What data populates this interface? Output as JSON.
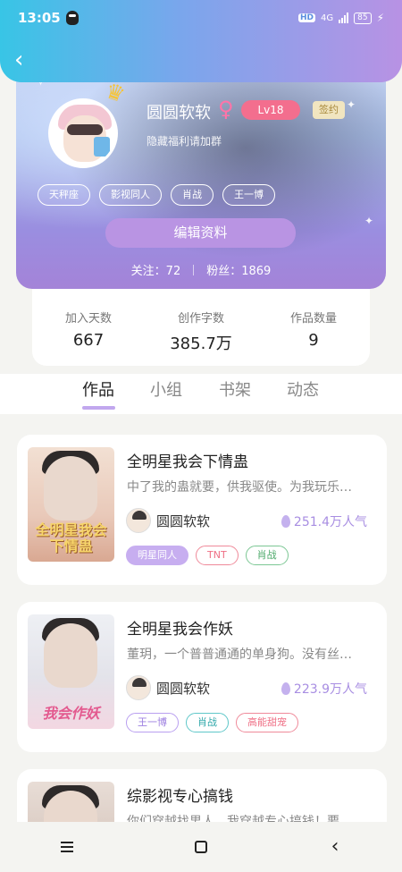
{
  "status_bar": {
    "time": "13:05",
    "network": "4G",
    "battery": "85"
  },
  "profile": {
    "username": "圆圆软软",
    "gender_symbol": "♀",
    "level": "Lv18",
    "sign_badge": "签约",
    "bio": "隐藏福利请加群",
    "tags": [
      "天秤座",
      "影视同人",
      "肖战",
      "王一博"
    ],
    "edit_button": "编辑资料",
    "follow_text": "关注：72",
    "fans_text": "粉丝：1869"
  },
  "stats": [
    {
      "label": "加入天数",
      "value": "667"
    },
    {
      "label": "创作字数",
      "value": "385.7万"
    },
    {
      "label": "作品数量",
      "value": "9"
    }
  ],
  "tabs": [
    {
      "label": "作品",
      "active": true
    },
    {
      "label": "小组",
      "active": false
    },
    {
      "label": "书架",
      "active": false
    },
    {
      "label": "动态",
      "active": false
    }
  ],
  "works": [
    {
      "title": "全明星我会下情蛊",
      "desc": "中了我的蛊就要，供我驱使。为我玩乐…",
      "author": "圆圆软软",
      "popularity": "251.4万人气",
      "cover_text": "全明星我会下情蛊",
      "chips": [
        {
          "label": "明星同人",
          "style": "filled"
        },
        {
          "label": "TNT",
          "style": "red"
        },
        {
          "label": "肖战",
          "style": "green"
        }
      ]
    },
    {
      "title": "全明星我会作妖",
      "desc": "董玥，一个普普通通的单身狗。没有丝…",
      "author": "圆圆软软",
      "popularity": "223.9万人气",
      "cover_text": "我会作妖",
      "chips": [
        {
          "label": "王一博",
          "style": "purple"
        },
        {
          "label": "肖战",
          "style": "teal"
        },
        {
          "label": "高能甜宠",
          "style": "red"
        }
      ]
    },
    {
      "title": "综影视专心搞钱",
      "desc": "你们穿越找男人，我穿越专心搞钱！要…",
      "author": "",
      "popularity": "",
      "cover_text": "",
      "chips": []
    }
  ],
  "colors": {
    "accent_purple": "#b994e3",
    "level_red": "#f36e8e",
    "tab_underline": "#c1a7ee",
    "popularity": "#a88ee2"
  }
}
